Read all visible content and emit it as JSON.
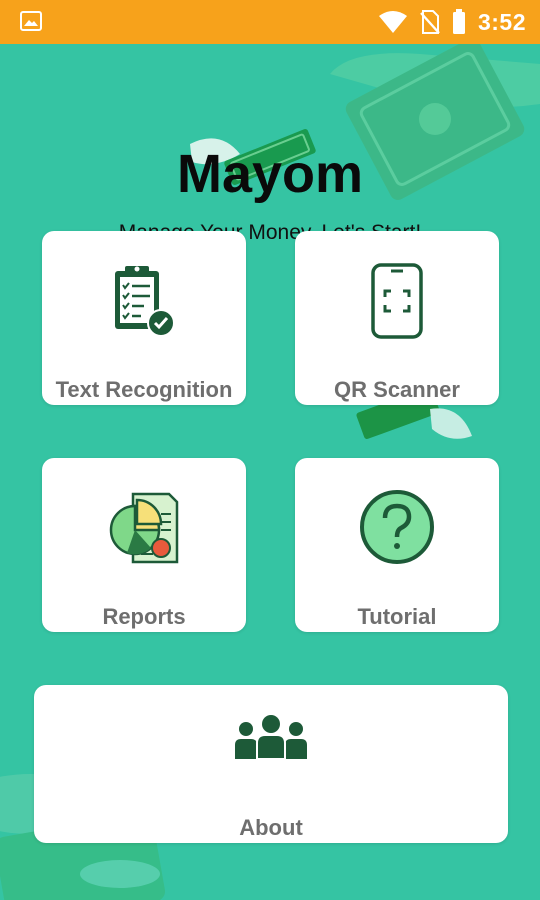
{
  "status_bar": {
    "time": "3:52",
    "icons": [
      "image-icon",
      "wifi-icon",
      "no-sim-icon",
      "battery-icon"
    ]
  },
  "app": {
    "title": "Mayom",
    "subtitle": "Manage Your Money. Let's Start!"
  },
  "menu": {
    "text_recognition": {
      "label": "Text Recognition",
      "icon": "clipboard-check-icon"
    },
    "qr_scanner": {
      "label": "QR Scanner",
      "icon": "phone-scan-icon"
    },
    "reports": {
      "label": "Reports",
      "icon": "report-chart-icon"
    },
    "tutorial": {
      "label": "Tutorial",
      "icon": "question-icon"
    },
    "about": {
      "label": "About",
      "icon": "people-group-icon"
    }
  },
  "colors": {
    "status_bar": "#f7a21b",
    "background": "#35c4a3",
    "card": "#ffffff",
    "icon_dark": "#1d5a38",
    "label": "#6e6e6e"
  }
}
